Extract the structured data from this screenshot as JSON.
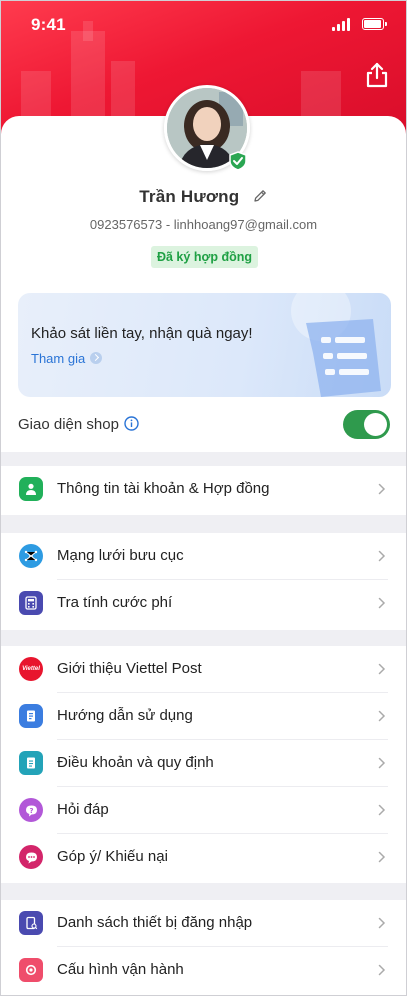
{
  "status": {
    "time": "9:41"
  },
  "profile": {
    "name": "Trần Hương",
    "contact": "0923576573 - linhhoang97@gmail.com",
    "badge": "Đã ký hợp đồng"
  },
  "survey": {
    "title": "Khảo sát liền tay, nhận quà ngay!",
    "link": "Tham gia"
  },
  "shop_mode": {
    "label": "Giao diện shop",
    "enabled": true
  },
  "groups": [
    {
      "items": [
        {
          "label": "Thông tin tài khoản & Hợp đồng",
          "icon": "user-icon",
          "color": "#21b05a"
        }
      ]
    },
    {
      "items": [
        {
          "label": "Mạng lưới bưu cục",
          "icon": "network-icon",
          "color": "#2d9be2"
        },
        {
          "label": "Tra tính cước phí",
          "icon": "calculator-icon",
          "color": "#4a4ab0"
        }
      ]
    },
    {
      "items": [
        {
          "label": "Giới thiệu Viettel Post",
          "icon": "viettel-logo-icon",
          "color": "#e8152e"
        },
        {
          "label": "Hướng dẫn sử dụng",
          "icon": "guide-icon",
          "color": "#3b7de0"
        },
        {
          "label": "Điều khoản và quy định",
          "icon": "document-icon",
          "color": "#23a3b8"
        },
        {
          "label": "Hỏi đáp",
          "icon": "faq-icon",
          "color": "#b258d8"
        },
        {
          "label": "Góp ý/ Khiếu nại",
          "icon": "feedback-icon",
          "color": "#d3256a"
        }
      ]
    },
    {
      "items": [
        {
          "label": "Danh sách thiết bị đăng nhập",
          "icon": "device-icon",
          "color": "#4a4ab0"
        },
        {
          "label": "Cấu hình vận hành",
          "icon": "settings-icon",
          "color": "#ef4d6b"
        }
      ]
    }
  ],
  "viettel_logo_text": "Viettel"
}
